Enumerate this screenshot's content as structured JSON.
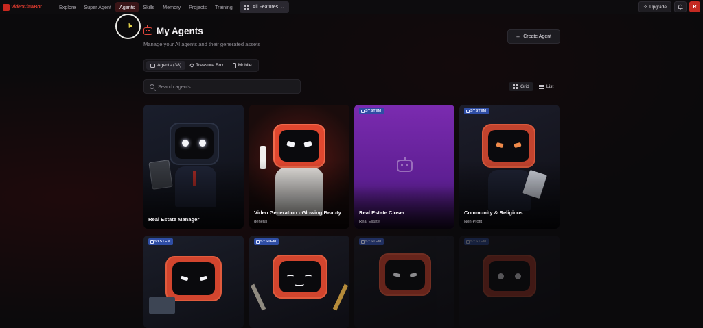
{
  "app": {
    "logo_text": "VideoClawBot"
  },
  "nav": {
    "items": [
      {
        "label": "Explore"
      },
      {
        "label": "Super Agent"
      },
      {
        "label": "Agents",
        "active": true
      },
      {
        "label": "Skills"
      },
      {
        "label": "Memory"
      },
      {
        "label": "Projects"
      },
      {
        "label": "Training"
      }
    ],
    "features_label": "All Features",
    "upgrade_label": "Upgrade",
    "avatar_initial": "R"
  },
  "header": {
    "title": "My Agents",
    "subtitle": "Manage your AI agents and their generated assets",
    "create_label": "Create Agent"
  },
  "tabs": [
    {
      "label": "Agents (38)",
      "icon": "robot-icon",
      "active": true
    },
    {
      "label": "Treasure Box",
      "icon": "box-icon"
    },
    {
      "label": "Mobile",
      "icon": "phone-icon"
    }
  ],
  "search": {
    "placeholder": "Search agents..."
  },
  "view": {
    "grid_label": "Grid",
    "list_label": "List",
    "selected": "Grid"
  },
  "cards": [
    {
      "name": "Real Estate Manager",
      "category": "",
      "badge": ""
    },
    {
      "name": "Video Generation - Glowing Beauty",
      "category": "general",
      "badge": ""
    },
    {
      "name": "Real Estate Closer",
      "category": "Real Estate",
      "badge": "SYSTEM"
    },
    {
      "name": "Community & Religious",
      "category": "Non-Profit",
      "badge": "SYSTEM"
    },
    {
      "name": "",
      "category": "",
      "badge": "SYSTEM"
    },
    {
      "name": "",
      "category": "",
      "badge": "SYSTEM"
    },
    {
      "name": "",
      "category": "",
      "badge": "SYSTEM"
    },
    {
      "name": "",
      "category": "",
      "badge": "SYSTEM"
    }
  ],
  "colors": {
    "accent": "#c9281f",
    "active_nav": "#3a1517",
    "badge": "#2f4ea5",
    "system_card": "#7b2bb0"
  }
}
